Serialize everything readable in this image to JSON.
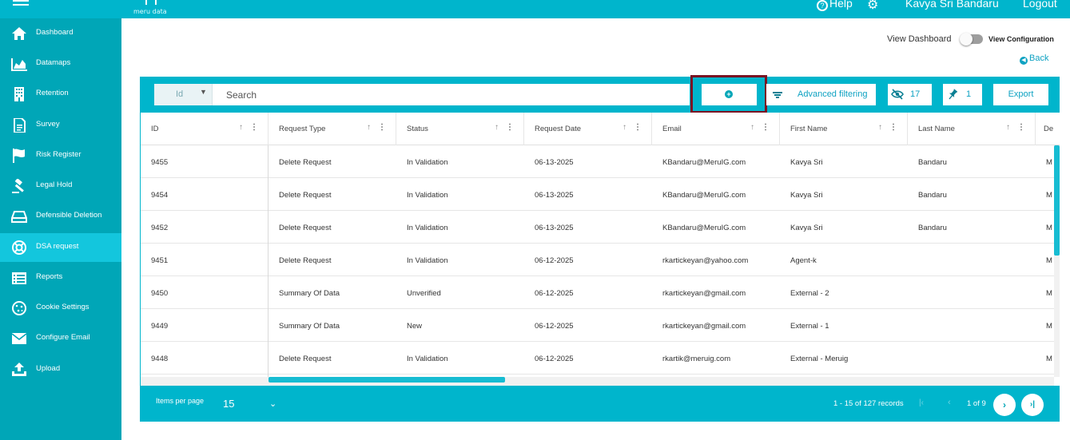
{
  "topbar": {
    "logo_text": "meru data",
    "help_label": "Help",
    "user_name": "Kavya Sri Bandaru",
    "logout_label": "Logout"
  },
  "sidebar": {
    "items": [
      {
        "label": "Dashboard",
        "icon": "home-icon",
        "active": false
      },
      {
        "label": "Datamaps",
        "icon": "area-chart-icon",
        "active": false
      },
      {
        "label": "Retention",
        "icon": "building-icon",
        "active": false
      },
      {
        "label": "Survey",
        "icon": "document-icon",
        "active": false
      },
      {
        "label": "Risk Register",
        "icon": "flag-icon",
        "active": false
      },
      {
        "label": "Legal Hold",
        "icon": "gavel-icon",
        "active": false
      },
      {
        "label": "Defensible Deletion",
        "icon": "drive-icon",
        "active": false
      },
      {
        "label": "DSA request",
        "icon": "lifebuoy-icon",
        "active": true
      },
      {
        "label": "Reports",
        "icon": "list-icon",
        "active": false
      },
      {
        "label": "Cookie Settings",
        "icon": "cookie-icon",
        "active": false
      },
      {
        "label": "Configure Email",
        "icon": "envelope-icon",
        "active": false
      },
      {
        "label": "Upload",
        "icon": "upload-icon",
        "active": false
      }
    ]
  },
  "header": {
    "view_dashboard_label": "View Dashboard",
    "view_configuration_label": "View Configuration",
    "back_label": "Back"
  },
  "toolbar": {
    "id_select_value": "Id",
    "search_placeholder": "Search",
    "advanced_filtering_label": "Advanced filtering",
    "hidden_columns_count": "17",
    "pinned_count": "1",
    "export_label": "Export"
  },
  "table": {
    "columns": [
      "ID",
      "Request Type",
      "Status",
      "Request Date",
      "Email",
      "First Name",
      "Last Name",
      "De"
    ],
    "rows": [
      {
        "id": "9455",
        "type": "Delete Request",
        "status": "In Validation",
        "date": "06-13-2025",
        "email": "KBandaru@MeruIG.com",
        "first": "Kavya Sri",
        "last": "Bandaru",
        "extra": "M"
      },
      {
        "id": "9454",
        "type": "Delete Request",
        "status": "In Validation",
        "date": "06-13-2025",
        "email": "KBandaru@MeruIG.com",
        "first": "Kavya Sri",
        "last": "Bandaru",
        "extra": "M"
      },
      {
        "id": "9452",
        "type": "Delete Request",
        "status": "In Validation",
        "date": "06-13-2025",
        "email": "KBandaru@MeruIG.com",
        "first": "Kavya Sri",
        "last": "Bandaru",
        "extra": "M"
      },
      {
        "id": "9451",
        "type": "Delete Request",
        "status": "In Validation",
        "date": "06-12-2025",
        "email": "rkartickeyan@yahoo.com",
        "first": "Agent-k",
        "last": "",
        "extra": "M"
      },
      {
        "id": "9450",
        "type": "Summary Of Data",
        "status": "Unverified",
        "date": "06-12-2025",
        "email": "rkartickeyan@gmail.com",
        "first": "External - 2",
        "last": "",
        "extra": "M"
      },
      {
        "id": "9449",
        "type": "Summary Of Data",
        "status": "New",
        "date": "06-12-2025",
        "email": "rkartickeyan@gmail.com",
        "first": "External - 1",
        "last": "",
        "extra": "M"
      },
      {
        "id": "9448",
        "type": "Delete Request",
        "status": "In Validation",
        "date": "06-12-2025",
        "email": "rkartik@meruig.com",
        "first": "External - Meruig",
        "last": "",
        "extra": "M"
      }
    ]
  },
  "paginator": {
    "items_per_page_label": "Items per page",
    "page_size": "15",
    "range_label": "1 - 15 of 127 records",
    "page_label": "1 of 9"
  },
  "colors": {
    "brand": "#00b5cc",
    "sidebar": "#00a6b7",
    "active": "#13c6dd",
    "highlight_border": "#7b1423"
  }
}
